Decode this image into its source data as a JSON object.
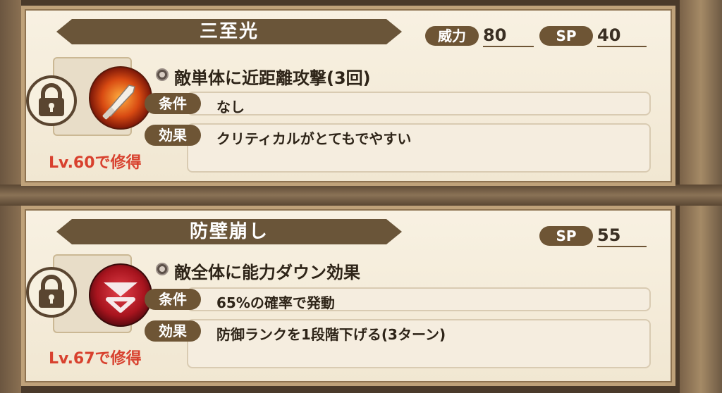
{
  "skills": [
    {
      "name": "三至光",
      "power_label": "威力",
      "power": "80",
      "sp_label": "SP",
      "sp": "40",
      "description": "敵単体に近距離攻撃(3回)",
      "condition_label": "条件",
      "condition": "なし",
      "effect_label": "効果",
      "effect": "クリティカルがとてもでやすい",
      "learn": "Lv.60で修得",
      "icon": "sword-icon",
      "locked": true
    },
    {
      "name": "防壁崩し",
      "sp_label": "SP",
      "sp": "55",
      "description": "敵全体に能力ダウン効果",
      "condition_label": "条件",
      "condition": "65%の確率で発動",
      "effect_label": "効果",
      "effect": "防御ランクを1段階下げる(3ターン)",
      "learn": "Lv.67で修得",
      "icon": "defense-down-icon",
      "locked": true
    }
  ],
  "colors": {
    "banner": "#6a5539",
    "pill": "#6e5535",
    "learn_text": "#d8412e",
    "card_bg": "#f8f1e2"
  }
}
